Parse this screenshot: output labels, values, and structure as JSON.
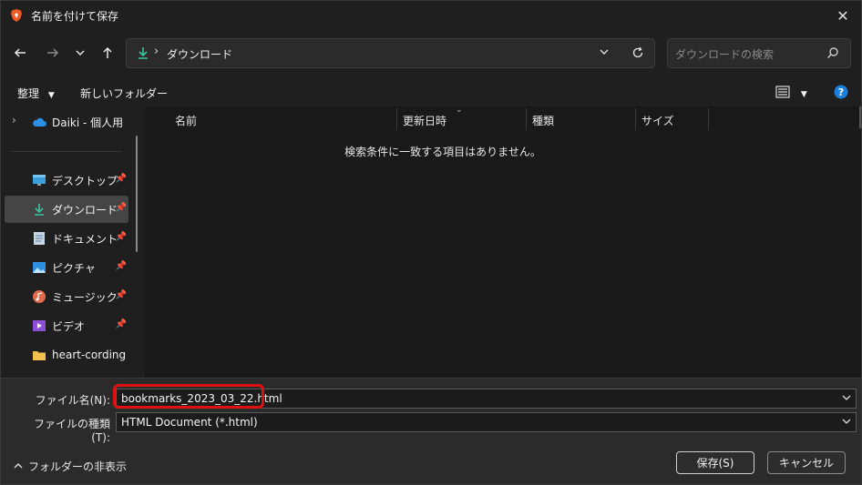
{
  "window": {
    "title": "名前を付けて保存",
    "close_icon": "close-icon"
  },
  "nav": {
    "back_icon": "arrow-left-icon",
    "forward_icon": "arrow-right-icon",
    "recent_icon": "chevron-down-icon",
    "up_icon": "arrow-up-icon",
    "address_path": "ダウンロード",
    "search_placeholder": "ダウンロードの検索"
  },
  "toolbar": {
    "organize_label": "整理",
    "new_folder_label": "新しいフォルダー"
  },
  "sidebar": {
    "onedrive_label": "Daiki - 個人用",
    "items": [
      {
        "label": "デスクトップ",
        "icon": "desktop-icon",
        "pinned": true
      },
      {
        "label": "ダウンロード",
        "icon": "download-icon",
        "pinned": true
      },
      {
        "label": "ドキュメント",
        "icon": "document-icon",
        "pinned": true
      },
      {
        "label": "ピクチャ",
        "icon": "pictures-icon",
        "pinned": true
      },
      {
        "label": "ミュージック",
        "icon": "music-icon",
        "pinned": true
      },
      {
        "label": "ビデオ",
        "icon": "video-icon",
        "pinned": true
      },
      {
        "label": "heart-cording",
        "icon": "folder-icon",
        "pinned": false
      }
    ]
  },
  "filelist": {
    "columns": [
      "名前",
      "更新日時",
      "種類",
      "サイズ"
    ],
    "empty_message": "検索条件に一致する項目はありません。"
  },
  "form": {
    "filename_label": "ファイル名(N):",
    "filename_value": "bookmarks_2023_03_22.html",
    "filetype_label": "ファイルの種類(T):",
    "filetype_value": "HTML Document (*.html)"
  },
  "footer": {
    "hide_folders_label": "フォルダーの非表示",
    "save_label": "保存(S)",
    "cancel_label": "キャンセル"
  },
  "colors": {
    "highlight": "#e01010",
    "accent_download": "#3bc4a0",
    "help_blue": "#1a7fe0"
  }
}
